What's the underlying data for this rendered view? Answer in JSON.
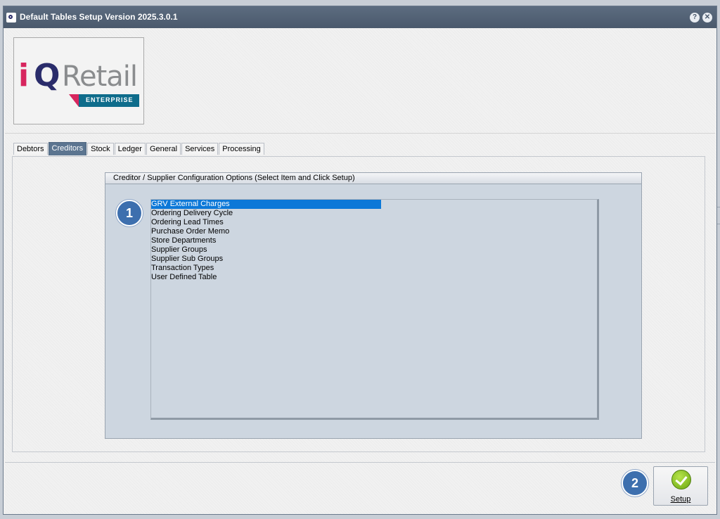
{
  "window": {
    "title": "Default Tables Setup Version 2025.3.0.1",
    "help_glyph": "?",
    "close_glyph": "✕"
  },
  "logo": {
    "i": "i",
    "q": "Q",
    "retail": "Retail",
    "band": "ENTERPRISE"
  },
  "tabs": [
    {
      "label": "Debtors",
      "active": false
    },
    {
      "label": "Creditors",
      "active": true
    },
    {
      "label": "Stock",
      "active": false
    },
    {
      "label": "Ledger",
      "active": false
    },
    {
      "label": "General",
      "active": false
    },
    {
      "label": "Services",
      "active": false
    },
    {
      "label": "Processing",
      "active": false
    }
  ],
  "group": {
    "title": "Creditor / Supplier Configuration Options (Select Item and Click Setup)",
    "items": [
      "GRV External Charges",
      "Ordering Delivery Cycle",
      "Ordering Lead Times",
      "Purchase Order Memo",
      "Store Departments",
      "Supplier Groups",
      "Supplier Sub Groups",
      "Transaction Types",
      "User Defined Table"
    ],
    "selected_index": 0
  },
  "badges": {
    "one": "1",
    "two": "2"
  },
  "setup_button": {
    "label": "Setup",
    "icon": "check-icon"
  },
  "colors": {
    "titlebar": "#4f5e72",
    "tab_active": "#5c7590",
    "selection": "#0c78d8",
    "badge": "#3d6fae",
    "check": "#7cbf1e"
  }
}
